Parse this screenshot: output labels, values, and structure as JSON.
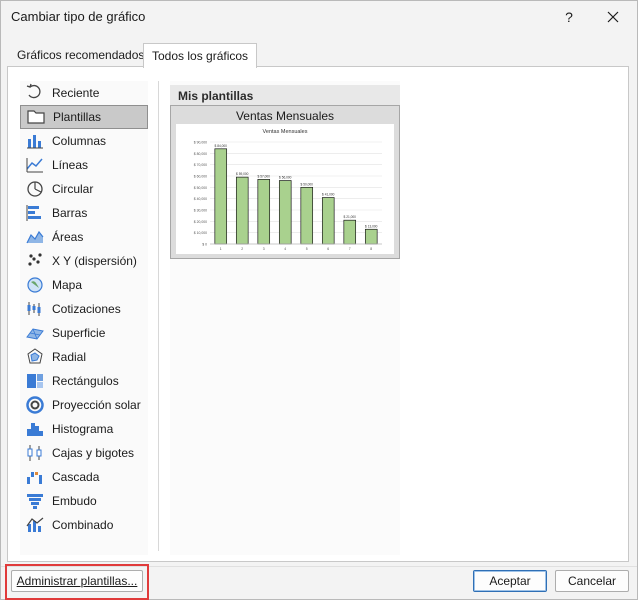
{
  "window": {
    "title": "Cambiar tipo de gráfico",
    "help_label": "?",
    "close_label": "✕"
  },
  "tabs": [
    {
      "label": "Gráficos recomendados",
      "active": false
    },
    {
      "label": "Todos los gráficos",
      "active": true
    }
  ],
  "chart_types": [
    {
      "label": "Reciente",
      "icon": "recent-icon"
    },
    {
      "label": "Plantillas",
      "icon": "templates-folder-icon",
      "selected": true
    },
    {
      "label": "Columnas",
      "icon": "column-chart-icon"
    },
    {
      "label": "Líneas",
      "icon": "line-chart-icon"
    },
    {
      "label": "Circular",
      "icon": "pie-chart-icon"
    },
    {
      "label": "Barras",
      "icon": "bar-chart-icon"
    },
    {
      "label": "Áreas",
      "icon": "area-chart-icon"
    },
    {
      "label": "X Y (dispersión)",
      "icon": "scatter-chart-icon"
    },
    {
      "label": "Mapa",
      "icon": "map-chart-icon"
    },
    {
      "label": "Cotizaciones",
      "icon": "stock-chart-icon"
    },
    {
      "label": "Superficie",
      "icon": "surface-chart-icon"
    },
    {
      "label": "Radial",
      "icon": "radar-chart-icon"
    },
    {
      "label": "Rectángulos",
      "icon": "treemap-chart-icon"
    },
    {
      "label": "Proyección solar",
      "icon": "sunburst-chart-icon"
    },
    {
      "label": "Histograma",
      "icon": "histogram-chart-icon"
    },
    {
      "label": "Cajas y bigotes",
      "icon": "box-whisker-chart-icon"
    },
    {
      "label": "Cascada",
      "icon": "waterfall-chart-icon"
    },
    {
      "label": "Embudo",
      "icon": "funnel-chart-icon"
    },
    {
      "label": "Combinado",
      "icon": "combo-chart-icon"
    }
  ],
  "templates": {
    "section_title": "Mis plantillas",
    "items": [
      {
        "label": "Ventas Mensuales"
      }
    ]
  },
  "preview_chart": {
    "title": "Ventas Mensuales",
    "y_ticks": [
      "$ 0",
      "$ 10,000",
      "$ 20,000",
      "$ 30,000",
      "$ 40,000",
      "$ 50,000",
      "$ 60,000",
      "$ 70,000",
      "$ 80,000",
      "$ 90,000"
    ],
    "categories": [
      "1",
      "2",
      "3",
      "4",
      "5",
      "6",
      "7",
      "8"
    ],
    "values": [
      84000,
      59000,
      57000,
      56000,
      50000,
      41000,
      21000,
      13000
    ],
    "data_labels": [
      "$ 84,000",
      "$ 59,000",
      "$ 57,000",
      "$ 56,000",
      "$ 50,000",
      "$ 41,000",
      "$ 21,000",
      "$ 13,000"
    ],
    "ylim": [
      0,
      90000
    ],
    "bar_color": "#a9d18e",
    "bar_border": "#1b1b1b"
  },
  "footer": {
    "manage_label": "Administrar plantillas...",
    "ok_label": "Aceptar",
    "cancel_label": "Cancelar"
  },
  "colors": {
    "highlight": "#e03a3a",
    "accent": "#2f6fb5"
  }
}
